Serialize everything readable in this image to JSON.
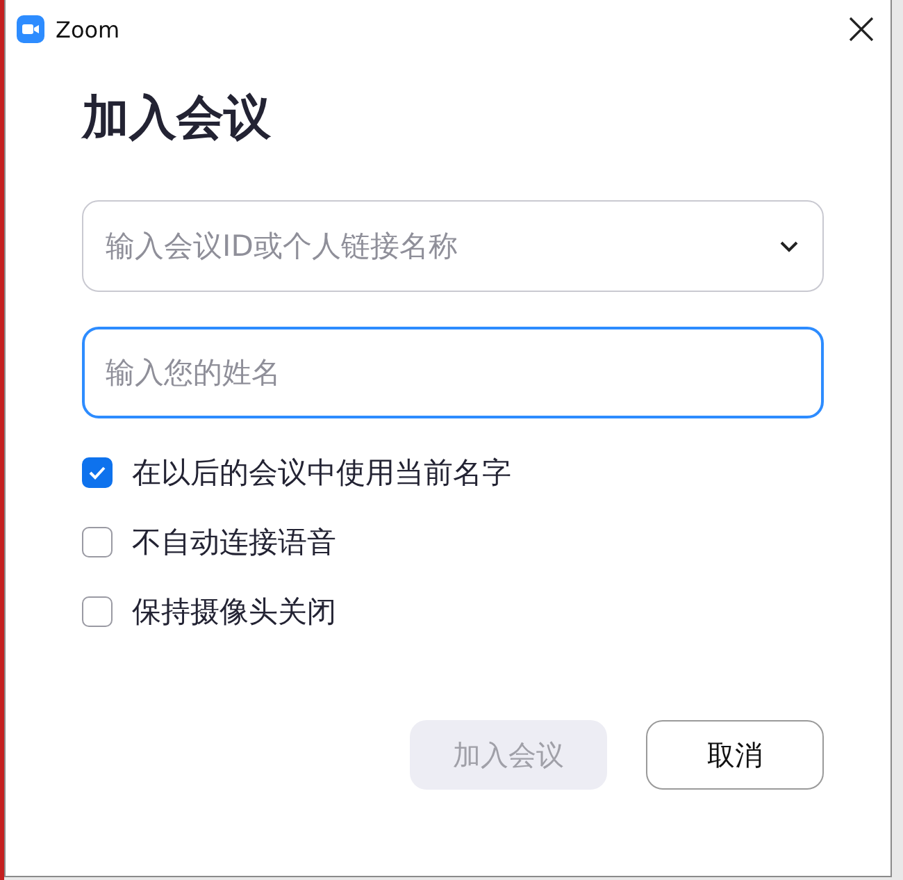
{
  "window": {
    "title": "Zoom"
  },
  "heading": "加入会议",
  "fields": [
    {
      "kind": "dropdown",
      "placeholder": "输入会议ID或个人链接名称",
      "focused": false
    },
    {
      "kind": "text",
      "placeholder": "输入您的姓名",
      "focused": true
    }
  ],
  "options": [
    {
      "label": "在以后的会议中使用当前名字",
      "checked": true
    },
    {
      "label": "不自动连接语音",
      "checked": false
    },
    {
      "label": "保持摄像头关闭",
      "checked": false
    }
  ],
  "buttons": [
    {
      "label": "加入会议",
      "disabled": true
    },
    {
      "label": "取消",
      "disabled": false
    }
  ]
}
